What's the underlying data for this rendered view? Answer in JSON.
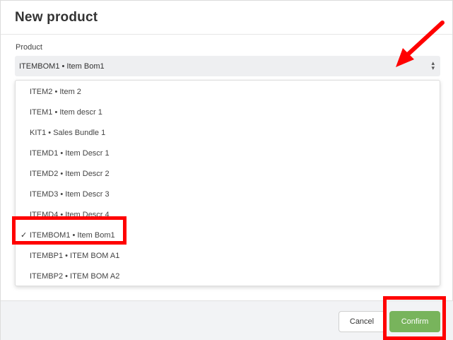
{
  "modal": {
    "title": "New product",
    "product_label": "Product",
    "selected_value": "ITEMBOM1  •  Item Bom1",
    "options": [
      {
        "label": "ITEM2 • Item 2",
        "selected": false
      },
      {
        "label": "ITEM1 • Item descr 1",
        "selected": false
      },
      {
        "label": "KIT1 • Sales Bundle 1",
        "selected": false
      },
      {
        "label": "ITEMD1 • Item Descr 1",
        "selected": false
      },
      {
        "label": "ITEMD2 • Item Descr 2",
        "selected": false
      },
      {
        "label": "ITEMD3 • Item Descr 3",
        "selected": false
      },
      {
        "label": "ITEMD4 • Item Descr 4",
        "selected": false
      },
      {
        "label": "ITEMBOM1 • Item Bom1",
        "selected": true
      },
      {
        "label": "ITEMBP1 • ITEM BOM A1",
        "selected": false
      },
      {
        "label": "ITEMBP2 • ITEM BOM A2",
        "selected": false
      }
    ],
    "check_glyph": "✓",
    "cancel_label": "Cancel",
    "confirm_label": "Confirm"
  },
  "icons": {
    "select_arrows": "updown-chevron-icon",
    "check": "check-icon"
  },
  "colors": {
    "confirm_bg": "#78b45c",
    "annotation": "#ff0000",
    "select_bg": "#eeeff1",
    "footer_bg": "#f2f3f5"
  }
}
